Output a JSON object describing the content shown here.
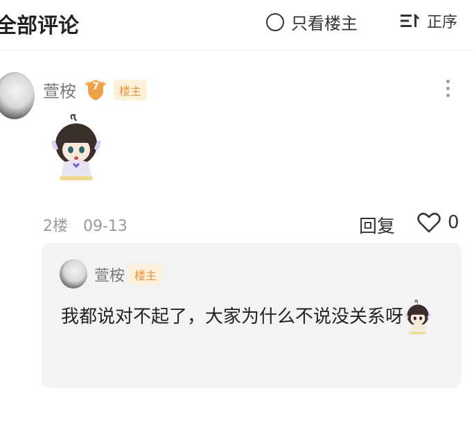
{
  "header": {
    "title": "全部评论",
    "only_op_label": "只看楼主",
    "sort_label": "正序"
  },
  "comment": {
    "author": "萱桉",
    "level": "7",
    "op_tag": "楼主",
    "floor": "2楼",
    "date": "09-13",
    "reply_label": "回复",
    "like_count": "0"
  },
  "reply": {
    "author": "萱桉",
    "op_tag": "楼主",
    "text": "我都说对不起了，大家为什么不说没关系呀"
  },
  "colors": {
    "op_tag_bg": "#fff0d9",
    "op_tag_text": "#e8923a",
    "badge": "#f0a24a",
    "reply_bg": "#f3f3f5"
  }
}
